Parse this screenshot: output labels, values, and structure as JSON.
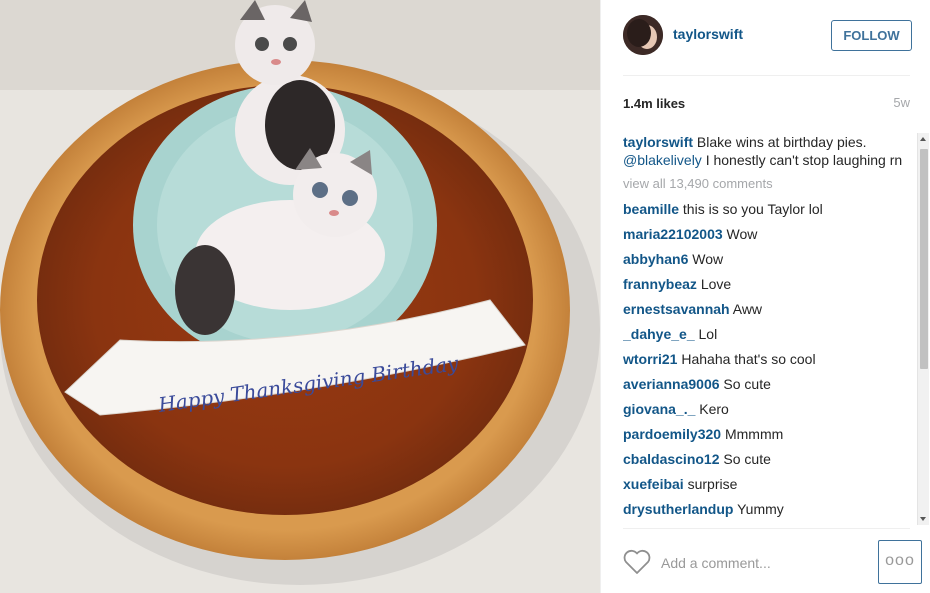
{
  "post": {
    "image_alt": "Pumpkin pie topped with two sugar cat figurines and a banner",
    "banner_text": "Happy Thanksgiving Birthday"
  },
  "header": {
    "username": "taylorswift",
    "follow_label": "FOLLOW"
  },
  "meta": {
    "likes": "1.4m likes",
    "age": "5w"
  },
  "caption": {
    "username": "taylorswift",
    "text_before": " Blake wins at birthday pies. ",
    "mention": "@blakelively",
    "text_after": " I honestly can't stop laughing rn"
  },
  "view_all": "view all 13,490 comments",
  "comments": [
    {
      "user": "beamille",
      "text": "this is so you Taylor lol"
    },
    {
      "user": "maria22102003",
      "text": "Wow"
    },
    {
      "user": "abbyhan6",
      "text": "Wow"
    },
    {
      "user": "frannybeaz",
      "text": "Love"
    },
    {
      "user": "ernestsavannah",
      "text": "Aww"
    },
    {
      "user": "_dahye_e_",
      "text": "Lol"
    },
    {
      "user": "wtorri21",
      "text": "Hahaha that's so cool"
    },
    {
      "user": "averianna9006",
      "text": "So cute"
    },
    {
      "user": "giovana_._",
      "text": "Kero"
    },
    {
      "user": "pardoemily320",
      "text": "Mmmmm"
    },
    {
      "user": "cbaldascino12",
      "text": "So cute"
    },
    {
      "user": "xuefeibai",
      "text": "surprise"
    },
    {
      "user": "drysutherlandup",
      "text": "Yummy"
    }
  ],
  "footer": {
    "comment_placeholder": "Add a comment...",
    "more_label": "ooo"
  },
  "colors": {
    "link": "#125688",
    "follow_border": "#3f729b",
    "muted": "#a5a7aa"
  },
  "icons": {
    "like": "heart-outline-icon",
    "more": "more-options-icon"
  }
}
